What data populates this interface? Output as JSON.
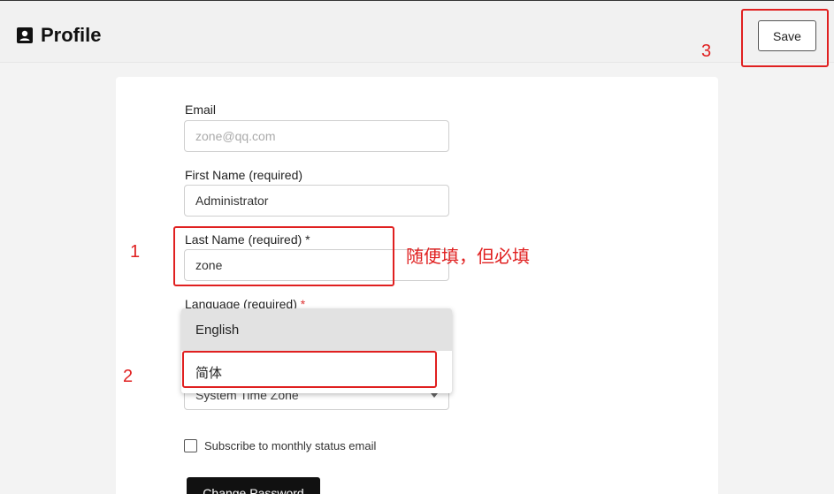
{
  "header": {
    "title": "Profile",
    "save_label": "Save"
  },
  "form": {
    "email": {
      "label": "Email",
      "placeholder": "zone@qq.com",
      "value": ""
    },
    "first_name": {
      "label": "First Name (required)",
      "value": "Administrator"
    },
    "last_name": {
      "label": "Last Name (required) *",
      "value": "zone"
    },
    "language": {
      "label": "Language (required)",
      "star": "*",
      "options": [
        "English",
        "简体"
      ],
      "highlighted": "English"
    },
    "timezone": {
      "value": "System Time Zone"
    },
    "subscribe_label": "Subscribe to monthly status email",
    "change_password_label": "Change Password"
  },
  "annotations": {
    "step1": "1",
    "step2": "2",
    "step3": "3",
    "note": "随便填，但必填",
    "color": "#e02020"
  }
}
